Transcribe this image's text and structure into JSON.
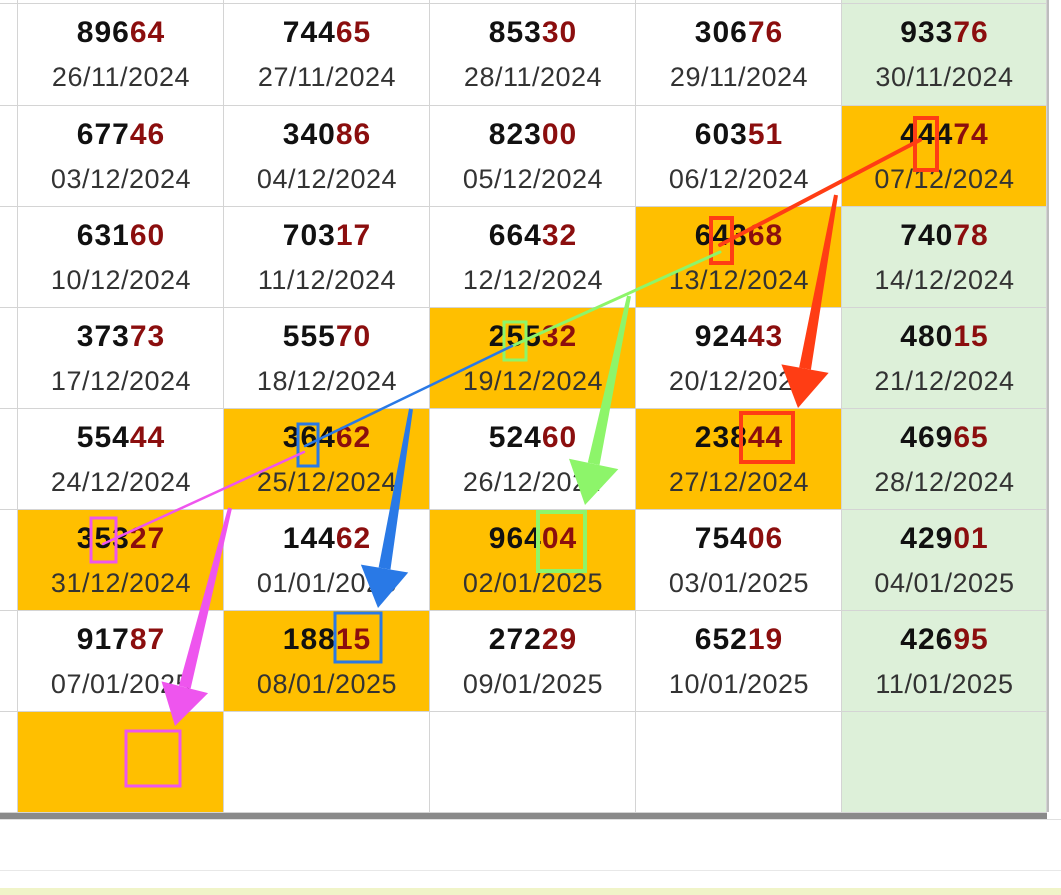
{
  "colors": {
    "highlight": "#ffbf00",
    "green_column": "#ddf0d9",
    "number_lead": "#111111",
    "number_tail": "#8b0e0e",
    "red_arrow": "#ff3d14",
    "green_arrow": "#8df56a",
    "blue_arrow": "#2979e6",
    "magenta_arrow": "#ee55ee"
  },
  "grid": {
    "rows": [
      [
        {
          "lead": "896",
          "tail": "64",
          "date": "26/11/2024"
        },
        {
          "lead": "744",
          "tail": "65",
          "date": "27/11/2024"
        },
        {
          "lead": "853",
          "tail": "30",
          "date": "28/11/2024"
        },
        {
          "lead": "306",
          "tail": "76",
          "date": "29/11/2024"
        },
        {
          "lead": "933",
          "tail": "76",
          "date": "30/11/2024"
        }
      ],
      [
        {
          "lead": "677",
          "tail": "46",
          "date": "03/12/2024"
        },
        {
          "lead": "340",
          "tail": "86",
          "date": "04/12/2024"
        },
        {
          "lead": "823",
          "tail": "00",
          "date": "05/12/2024"
        },
        {
          "lead": "603",
          "tail": "51",
          "date": "06/12/2024"
        },
        {
          "lead": "444",
          "tail": "74",
          "date": "07/12/2024",
          "highlight": true
        }
      ],
      [
        {
          "lead": "631",
          "tail": "60",
          "date": "10/12/2024"
        },
        {
          "lead": "703",
          "tail": "17",
          "date": "11/12/2024"
        },
        {
          "lead": "664",
          "tail": "32",
          "date": "12/12/2024"
        },
        {
          "lead": "643",
          "tail": "68",
          "date": "13/12/2024",
          "highlight": true
        },
        {
          "lead": "740",
          "tail": "78",
          "date": "14/12/2024"
        }
      ],
      [
        {
          "lead": "373",
          "tail": "73",
          "date": "17/12/2024"
        },
        {
          "lead": "555",
          "tail": "70",
          "date": "18/12/2024"
        },
        {
          "lead": "255",
          "tail": "32",
          "date": "19/12/2024",
          "highlight": true
        },
        {
          "lead": "924",
          "tail": "43",
          "date": "20/12/2024"
        },
        {
          "lead": "480",
          "tail": "15",
          "date": "21/12/2024"
        }
      ],
      [
        {
          "lead": "554",
          "tail": "44",
          "date": "24/12/2024"
        },
        {
          "lead": "364",
          "tail": "62",
          "date": "25/12/2024",
          "highlight": true
        },
        {
          "lead": "524",
          "tail": "60",
          "date": "26/12/2024"
        },
        {
          "lead": "238",
          "tail": "44",
          "date": "27/12/2024",
          "highlight": true
        },
        {
          "lead": "469",
          "tail": "65",
          "date": "28/12/2024"
        }
      ],
      [
        {
          "lead": "353",
          "tail": "27",
          "date": "31/12/2024",
          "highlight": true
        },
        {
          "lead": "144",
          "tail": "62",
          "date": "01/01/2025"
        },
        {
          "lead": "964",
          "tail": "04",
          "date": "02/01/2025",
          "highlight": true
        },
        {
          "lead": "754",
          "tail": "06",
          "date": "03/01/2025"
        },
        {
          "lead": "429",
          "tail": "01",
          "date": "04/01/2025"
        }
      ],
      [
        {
          "lead": "917",
          "tail": "87",
          "date": "07/01/2025"
        },
        {
          "lead": "188",
          "tail": "15",
          "date": "08/01/2025",
          "highlight": true
        },
        {
          "lead": "272",
          "tail": "29",
          "date": "09/01/2025"
        },
        {
          "lead": "652",
          "tail": "19",
          "date": "10/01/2025"
        },
        {
          "lead": "426",
          "tail": "95",
          "date": "11/01/2025"
        }
      ],
      [
        {
          "lead": "",
          "tail": "",
          "date": "",
          "highlight": true
        },
        {
          "lead": "",
          "tail": "",
          "date": ""
        },
        {
          "lead": "",
          "tail": "",
          "date": ""
        },
        {
          "lead": "",
          "tail": "",
          "date": ""
        },
        {
          "lead": "",
          "tail": "",
          "date": ""
        }
      ]
    ]
  }
}
